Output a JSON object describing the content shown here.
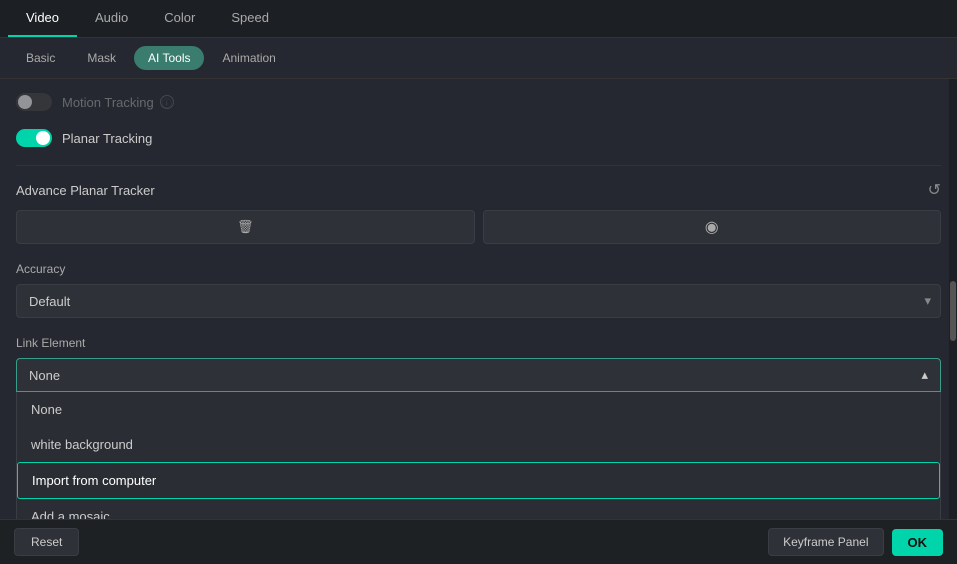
{
  "topTabs": {
    "tabs": [
      {
        "label": "Video",
        "active": true
      },
      {
        "label": "Audio",
        "active": false
      },
      {
        "label": "Color",
        "active": false
      },
      {
        "label": "Speed",
        "active": false
      }
    ]
  },
  "subTabs": {
    "tabs": [
      {
        "label": "Basic",
        "active": false
      },
      {
        "label": "Mask",
        "active": false
      },
      {
        "label": "AI Tools",
        "active": true
      },
      {
        "label": "Animation",
        "active": false
      }
    ]
  },
  "motionTracking": {
    "label": "Motion Tracking",
    "enabled": false
  },
  "planarTracking": {
    "label": "Planar Tracking",
    "enabled": true
  },
  "advancePlanarTracker": {
    "title": "Advance Planar Tracker",
    "deleteIcon": "🗑",
    "eyeIcon": "👁"
  },
  "accuracy": {
    "label": "Accuracy",
    "value": "Default",
    "chevron": "▾"
  },
  "linkElement": {
    "label": "Link Element",
    "value": "None",
    "chevronUp": "▴",
    "dropdownItems": [
      {
        "label": "None",
        "active": false
      },
      {
        "label": "white background",
        "active": false
      },
      {
        "label": "Import from computer",
        "active": true
      },
      {
        "label": "Add a mosaic",
        "active": false
      }
    ]
  },
  "bottomBar": {
    "resetLabel": "Reset",
    "keyframePanelLabel": "Keyframe Panel",
    "okLabel": "OK"
  },
  "icons": {
    "info": "ⓘ",
    "reset": "↺",
    "delete": "🗑",
    "eye": "◉",
    "chevronDown": "▾",
    "chevronUp": "▴"
  }
}
